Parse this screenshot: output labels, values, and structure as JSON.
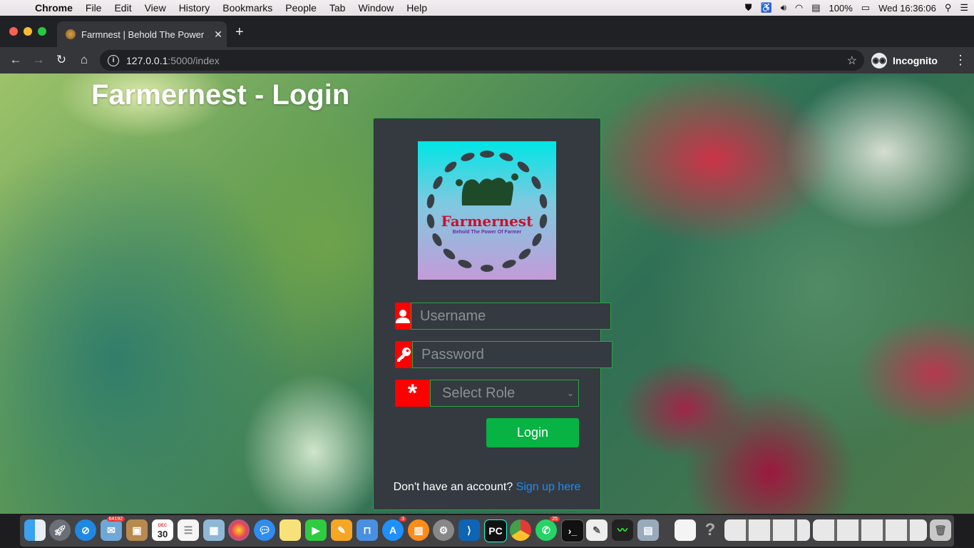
{
  "menubar": {
    "items": [
      "Chrome",
      "File",
      "Edit",
      "View",
      "History",
      "Bookmarks",
      "People",
      "Tab",
      "Window",
      "Help"
    ],
    "battery": "100%",
    "clock": "Wed 16:36:06"
  },
  "browser": {
    "tab_title": "Farmnest | Behold The Power",
    "url_host": "127.0.0.1",
    "url_path": ":5000/index",
    "incognito_label": "Incognito"
  },
  "page": {
    "title": "Farmernest - Login",
    "logo": {
      "brand": "Farmernest",
      "tagline": "Behold The Power Of Farmer"
    },
    "form": {
      "username_placeholder": "Username",
      "password_placeholder": "Password",
      "role_selected": "Select Role",
      "login_label": "Login"
    },
    "signup": {
      "prompt": "Don't have an account?",
      "link": "Sign up here"
    }
  },
  "dock": {
    "badges": {
      "mail": "64192",
      "calendar_day": "30",
      "calendar_month": "DEC",
      "appstore": "3",
      "whatsapp": "25"
    },
    "apps": [
      "finder-icon",
      "launchpad-icon",
      "safari-icon",
      "mail-icon",
      "contacts-icon",
      "calendar-icon",
      "reminders-icon",
      "preview-icon",
      "photos-icon",
      "messages-icon",
      "notes-icon",
      "facetime-icon",
      "pages-icon",
      "keynote-icon",
      "appstore-icon",
      "books-icon",
      "system-preferences-icon",
      "vscode-icon",
      "pycharm-icon",
      "chrome-icon",
      "whatsapp-icon",
      "terminal-icon",
      "textedit-icon",
      "activity-monitor-icon",
      "image-capture-icon"
    ]
  }
}
